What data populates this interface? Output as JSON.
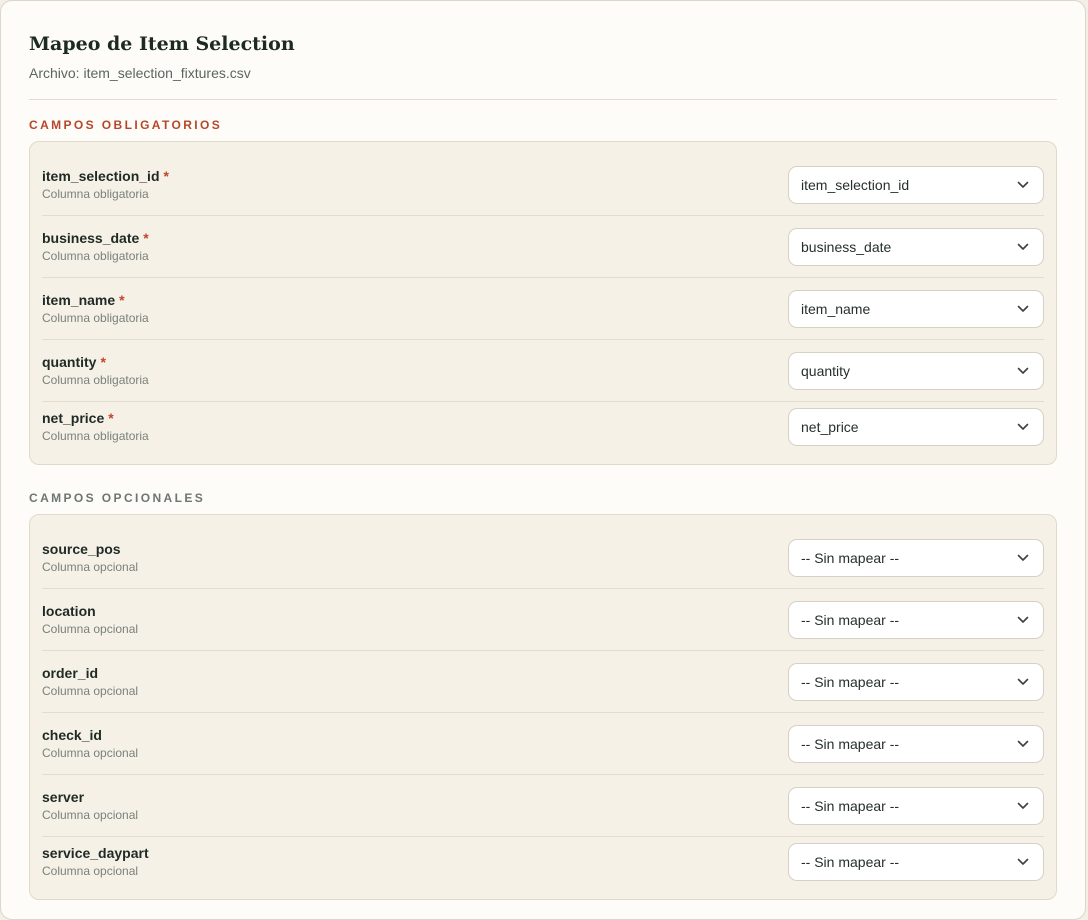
{
  "header": {
    "title": "Mapeo de Item Selection",
    "file_label": "Archivo: item_selection_fixtures.csv"
  },
  "required_section": {
    "label": "CAMPOS OBLIGATORIOS",
    "asterisk": "*",
    "fields": [
      {
        "name": "item_selection_id",
        "desc": "Columna obligatoria",
        "value": "item_selection_id"
      },
      {
        "name": "business_date",
        "desc": "Columna obligatoria",
        "value": "business_date"
      },
      {
        "name": "item_name",
        "desc": "Columna obligatoria",
        "value": "item_name"
      },
      {
        "name": "quantity",
        "desc": "Columna obligatoria",
        "value": "quantity"
      },
      {
        "name": "net_price",
        "desc": "Columna obligatoria",
        "value": "net_price"
      }
    ]
  },
  "optional_section": {
    "label": "CAMPOS OPCIONALES",
    "fields": [
      {
        "name": "source_pos",
        "desc": "Columna opcional",
        "value": "-- Sin mapear --"
      },
      {
        "name": "location",
        "desc": "Columna opcional",
        "value": "-- Sin mapear --"
      },
      {
        "name": "order_id",
        "desc": "Columna opcional",
        "value": "-- Sin mapear --"
      },
      {
        "name": "check_id",
        "desc": "Columna opcional",
        "value": "-- Sin mapear --"
      },
      {
        "name": "server",
        "desc": "Columna opcional",
        "value": "-- Sin mapear --"
      },
      {
        "name": "service_daypart",
        "desc": "Columna opcional",
        "value": "-- Sin mapear --"
      }
    ]
  },
  "icons": {
    "select_chevron": "chevron-down-icon"
  },
  "colors": {
    "required_accent": "#b5472a",
    "asterisk": "#c0452c",
    "optional_label": "#6d7671"
  }
}
